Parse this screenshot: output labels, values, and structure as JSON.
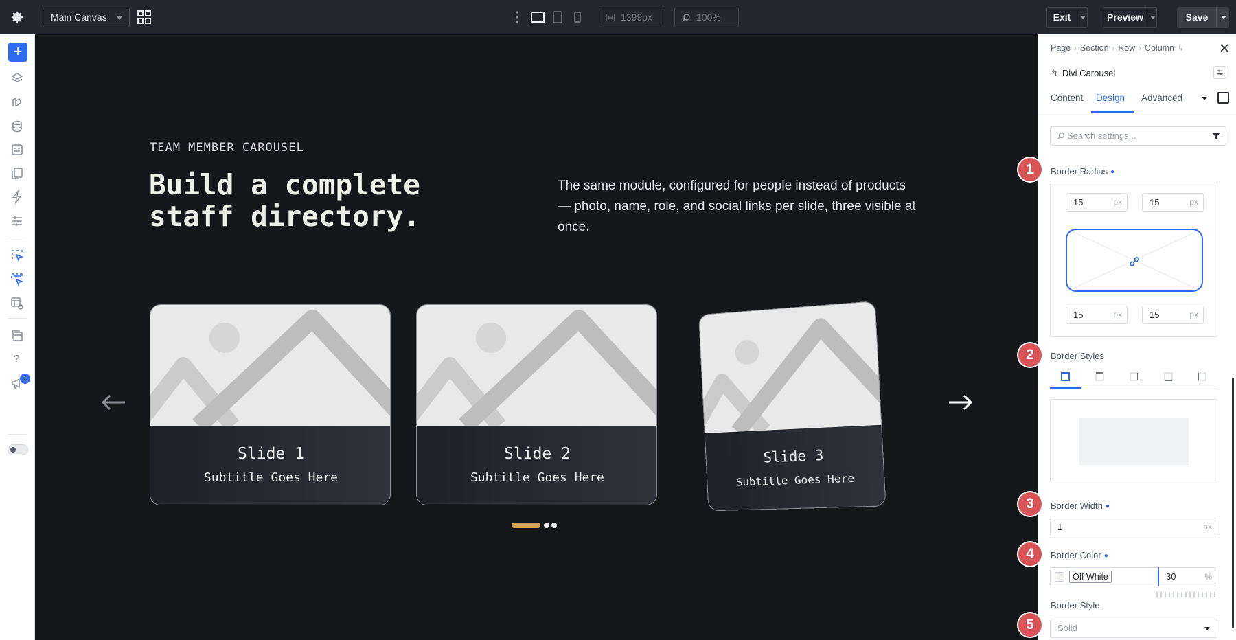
{
  "topbar": {
    "canvas_select": "Main Canvas",
    "width_value": "1399px",
    "zoom_value": "100%",
    "exit_label": "Exit",
    "preview_label": "Preview",
    "save_label": "Save"
  },
  "leftrail": {
    "notification_count": "1"
  },
  "canvas": {
    "eyebrow": "TEAM MEMBER CAROUSEL",
    "headline_line1": "Build a complete",
    "headline_line2": "staff directory.",
    "body": "The same module, configured for people instead of products — photo, name, role, and social links per slide, three visible at once.",
    "slides": [
      {
        "title": "Slide 1",
        "subtitle": "Subtitle Goes Here"
      },
      {
        "title": "Slide 2",
        "subtitle": "Subtitle Goes Here"
      },
      {
        "title": "Slide 3",
        "subtitle": "Subtitle Goes Here"
      }
    ],
    "accent_color": "#d7a253"
  },
  "panel": {
    "breadcrumbs": [
      "Page",
      "Section",
      "Row",
      "Column"
    ],
    "module_title": "Divi Carousel",
    "tabs": [
      "Content",
      "Design",
      "Advanced"
    ],
    "active_tab": "Design",
    "search_placeholder": "Search settings...",
    "steps": [
      "1",
      "2",
      "3",
      "4",
      "5"
    ],
    "border_radius": {
      "label": "Border Radius",
      "top_left": "15",
      "top_right": "15",
      "bottom_left": "15",
      "bottom_right": "15",
      "unit": "px"
    },
    "border_styles_label": "Border Styles",
    "border_width": {
      "label": "Border Width",
      "value": "1",
      "unit": "px"
    },
    "border_color": {
      "label": "Border Color",
      "name": "Off White",
      "opacity": "30",
      "unit": "%"
    },
    "border_style": {
      "label": "Border Style",
      "value": "Solid"
    },
    "accent_color": "#2d6af0",
    "step_color": "#d95457"
  }
}
